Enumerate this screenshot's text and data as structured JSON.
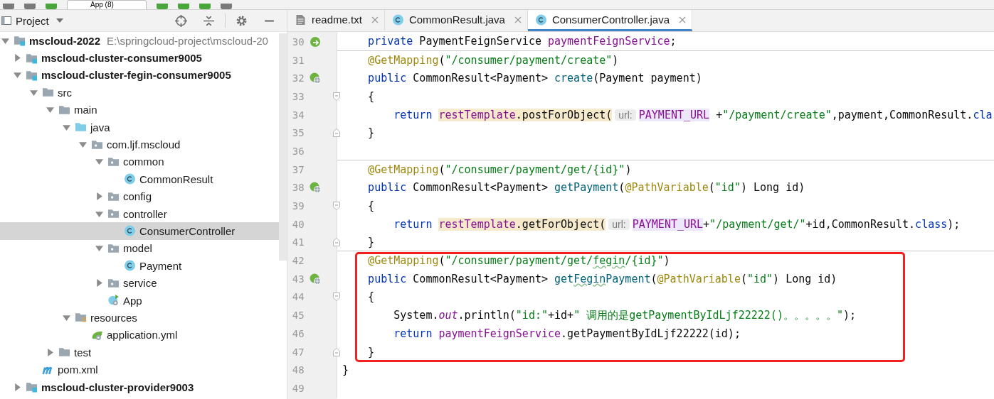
{
  "toolbar": {
    "run_config": "App (8)"
  },
  "project_panel": {
    "title": "Project",
    "tree": [
      {
        "label": "mscloud-2022",
        "detail": "E:\\springcloud-project\\mscloud-20",
        "kind": "module",
        "expanded": true,
        "selected": false,
        "children": [
          {
            "label": "mscloud-cluster-consumer9005",
            "kind": "module",
            "expanded": false,
            "selected": false
          },
          {
            "label": "mscloud-cluster-fegin-consumer9005",
            "kind": "module",
            "expanded": true,
            "selected": false,
            "children": [
              {
                "label": "src",
                "kind": "folder",
                "expanded": true,
                "selected": false,
                "children": [
                  {
                    "label": "main",
                    "kind": "folder",
                    "expanded": true,
                    "selected": false,
                    "children": [
                      {
                        "label": "java",
                        "kind": "source",
                        "expanded": true,
                        "selected": false,
                        "children": [
                          {
                            "label": "com.ljf.mscloud",
                            "kind": "package",
                            "expanded": true,
                            "selected": false,
                            "children": [
                              {
                                "label": "common",
                                "kind": "package",
                                "expanded": true,
                                "selected": false,
                                "children": [
                                  {
                                    "label": "CommonResult",
                                    "kind": "class",
                                    "selected": false
                                  }
                                ]
                              },
                              {
                                "label": "config",
                                "kind": "package",
                                "expanded": false,
                                "selected": false
                              },
                              {
                                "label": "controller",
                                "kind": "package",
                                "expanded": true,
                                "selected": false,
                                "children": [
                                  {
                                    "label": "ConsumerController",
                                    "kind": "class",
                                    "selected": true
                                  }
                                ]
                              },
                              {
                                "label": "model",
                                "kind": "package",
                                "expanded": true,
                                "selected": false,
                                "children": [
                                  {
                                    "label": "Payment",
                                    "kind": "class",
                                    "selected": false
                                  }
                                ]
                              },
                              {
                                "label": "service",
                                "kind": "package",
                                "expanded": false,
                                "selected": false
                              },
                              {
                                "label": "App",
                                "kind": "app",
                                "selected": false
                              }
                            ]
                          }
                        ]
                      },
                      {
                        "label": "resources",
                        "kind": "resources",
                        "expanded": true,
                        "selected": false,
                        "children": [
                          {
                            "label": "application.yml",
                            "kind": "yml",
                            "selected": false
                          }
                        ]
                      }
                    ]
                  },
                  {
                    "label": "test",
                    "kind": "folder",
                    "expanded": false,
                    "selected": false
                  }
                ]
              },
              {
                "label": "pom.xml",
                "kind": "maven",
                "selected": false
              }
            ]
          },
          {
            "label": "mscloud-cluster-provider9003",
            "kind": "module",
            "expanded": false,
            "selected": false
          }
        ]
      }
    ]
  },
  "tabs": [
    {
      "label": "readme.txt",
      "kind": "text",
      "selected": false
    },
    {
      "label": "CommonResult.java",
      "kind": "class",
      "selected": false
    },
    {
      "label": "ConsumerController.java",
      "kind": "class",
      "selected": true
    }
  ],
  "editor": {
    "lines": [
      {
        "number": "30",
        "gutter": {
          "kind": "bean"
        },
        "separator": true,
        "tokens": [
          {
            "kind": "kw",
            "t": "    private"
          },
          {
            "kind": "plain",
            "t": " PaymentFeignService "
          },
          {
            "kind": "field",
            "t": "paymentFeignService"
          },
          {
            "kind": "plain",
            "t": ";"
          }
        ]
      },
      {
        "number": "31",
        "tokens": [
          {
            "kind": "ann",
            "t": "    @GetMapping"
          },
          {
            "kind": "plain",
            "t": "("
          },
          {
            "kind": "str",
            "t": "\"/consumer/payment/create\""
          },
          {
            "kind": "plain",
            "t": ")"
          }
        ]
      },
      {
        "number": "32",
        "gutter": {
          "kind": "web"
        },
        "tokens": [
          {
            "kind": "kw",
            "t": "    public"
          },
          {
            "kind": "plain",
            "t": " CommonResult<Payment> "
          },
          {
            "kind": "method",
            "t": "create"
          },
          {
            "kind": "plain",
            "t": "(Payment payment)"
          }
        ]
      },
      {
        "number": "33",
        "fold": {
          "kind": "open"
        },
        "tokens": [
          {
            "kind": "plain",
            "t": "    {"
          }
        ]
      },
      {
        "number": "34",
        "tokens": [
          {
            "kind": "kw",
            "t": "        return "
          },
          {
            "kind": "fieldhl",
            "t": "restTemplate"
          },
          {
            "kind": "plainhl",
            "t": ".postForObject("
          },
          {
            "kind": "hint",
            "t": "url:"
          },
          {
            "kind": "const",
            "t": "PAYMENT_URL"
          },
          {
            "kind": "plain",
            "t": " +"
          },
          {
            "kind": "str",
            "t": "\"/payment/create\""
          },
          {
            "kind": "plain",
            "t": ",payment,CommonResult."
          },
          {
            "kind": "kw",
            "t": "cla"
          }
        ]
      },
      {
        "number": "35",
        "fold": {
          "kind": "close"
        },
        "tokens": [
          {
            "kind": "plain",
            "t": "    }"
          }
        ]
      },
      {
        "number": "36",
        "separator": true
      },
      {
        "number": "37",
        "tokens": [
          {
            "kind": "ann",
            "t": "    @GetMapping"
          },
          {
            "kind": "plain",
            "t": "("
          },
          {
            "kind": "str",
            "t": "\"/consumer/payment/get/{id}\""
          },
          {
            "kind": "plain",
            "t": ")"
          }
        ]
      },
      {
        "number": "38",
        "gutter": {
          "kind": "web"
        },
        "tokens": [
          {
            "kind": "kw",
            "t": "    public"
          },
          {
            "kind": "plain",
            "t": " CommonResult<Payment> "
          },
          {
            "kind": "method",
            "t": "getPayment"
          },
          {
            "kind": "plain",
            "t": "("
          },
          {
            "kind": "ann",
            "t": "@PathVariable"
          },
          {
            "kind": "plain",
            "t": "("
          },
          {
            "kind": "str",
            "t": "\"id\""
          },
          {
            "kind": "plain",
            "t": ") Long id)"
          }
        ]
      },
      {
        "number": "39",
        "fold": {
          "kind": "open"
        },
        "tokens": [
          {
            "kind": "plain",
            "t": "    {"
          }
        ]
      },
      {
        "number": "40",
        "tokens": [
          {
            "kind": "kw",
            "t": "        return "
          },
          {
            "kind": "fieldhl",
            "t": "restTemplate"
          },
          {
            "kind": "plainhl",
            "t": ".getForObject("
          },
          {
            "kind": "hint",
            "t": "url:"
          },
          {
            "kind": "const",
            "t": "PAYMENT_URL"
          },
          {
            "kind": "plain",
            "t": "+"
          },
          {
            "kind": "str",
            "t": "\"/payment/get/\""
          },
          {
            "kind": "plain",
            "t": "+id,CommonResult."
          },
          {
            "kind": "kw",
            "t": "class"
          },
          {
            "kind": "plain",
            "t": ");"
          }
        ]
      },
      {
        "number": "41",
        "fold": {
          "kind": "close"
        },
        "separator": true,
        "tokens": [
          {
            "kind": "plain",
            "t": "    }"
          }
        ]
      },
      {
        "number": "42",
        "marked": true,
        "tokens": [
          {
            "kind": "ann",
            "t": "    @GetMapping"
          },
          {
            "kind": "plain",
            "t": "("
          },
          {
            "kind": "str",
            "t": "\"/consumer/payment/get/"
          },
          {
            "kind": "strtypo",
            "t": "fegin"
          },
          {
            "kind": "str",
            "t": "/{id}\""
          },
          {
            "kind": "plain",
            "t": ")"
          }
        ]
      },
      {
        "number": "43",
        "gutter": {
          "kind": "web"
        },
        "marked": true,
        "tokens": [
          {
            "kind": "kw",
            "t": "    public"
          },
          {
            "kind": "plain",
            "t": " CommonResult<Payment> "
          },
          {
            "kind": "method",
            "t": "get"
          },
          {
            "kind": "methodtypo",
            "t": "Fegin"
          },
          {
            "kind": "method",
            "t": "Payment"
          },
          {
            "kind": "plain",
            "t": "("
          },
          {
            "kind": "ann",
            "t": "@PathVariable"
          },
          {
            "kind": "plain",
            "t": "("
          },
          {
            "kind": "str",
            "t": "\"id\""
          },
          {
            "kind": "plain",
            "t": ") Long id)"
          }
        ]
      },
      {
        "number": "44",
        "fold": {
          "kind": "open"
        },
        "marked": true,
        "tokens": [
          {
            "kind": "plain",
            "t": "    {"
          }
        ]
      },
      {
        "number": "45",
        "marked": true,
        "tokens": [
          {
            "kind": "plain",
            "t": "        System."
          },
          {
            "kind": "static",
            "t": "out"
          },
          {
            "kind": "plain",
            "t": ".println("
          },
          {
            "kind": "str",
            "t": "\"id:\""
          },
          {
            "kind": "plain",
            "t": "+id+"
          },
          {
            "kind": "str",
            "t": "\" 调用的是getPaymentByIdLjf22222()。。。。。\""
          },
          {
            "kind": "plain",
            "t": ");"
          }
        ]
      },
      {
        "number": "46",
        "marked": true,
        "tokens": [
          {
            "kind": "kw",
            "t": "        return "
          },
          {
            "kind": "field",
            "t": "paymentFeignService"
          },
          {
            "kind": "plain",
            "t": ".getPaymentByIdLjf22222(id);"
          }
        ]
      },
      {
        "number": "47",
        "fold": {
          "kind": "close"
        },
        "marked": true,
        "tokens": [
          {
            "kind": "plain",
            "t": "    }"
          }
        ]
      },
      {
        "number": "48",
        "tokens": [
          {
            "kind": "plain",
            "t": "}"
          }
        ]
      },
      {
        "number": "49"
      }
    ]
  }
}
